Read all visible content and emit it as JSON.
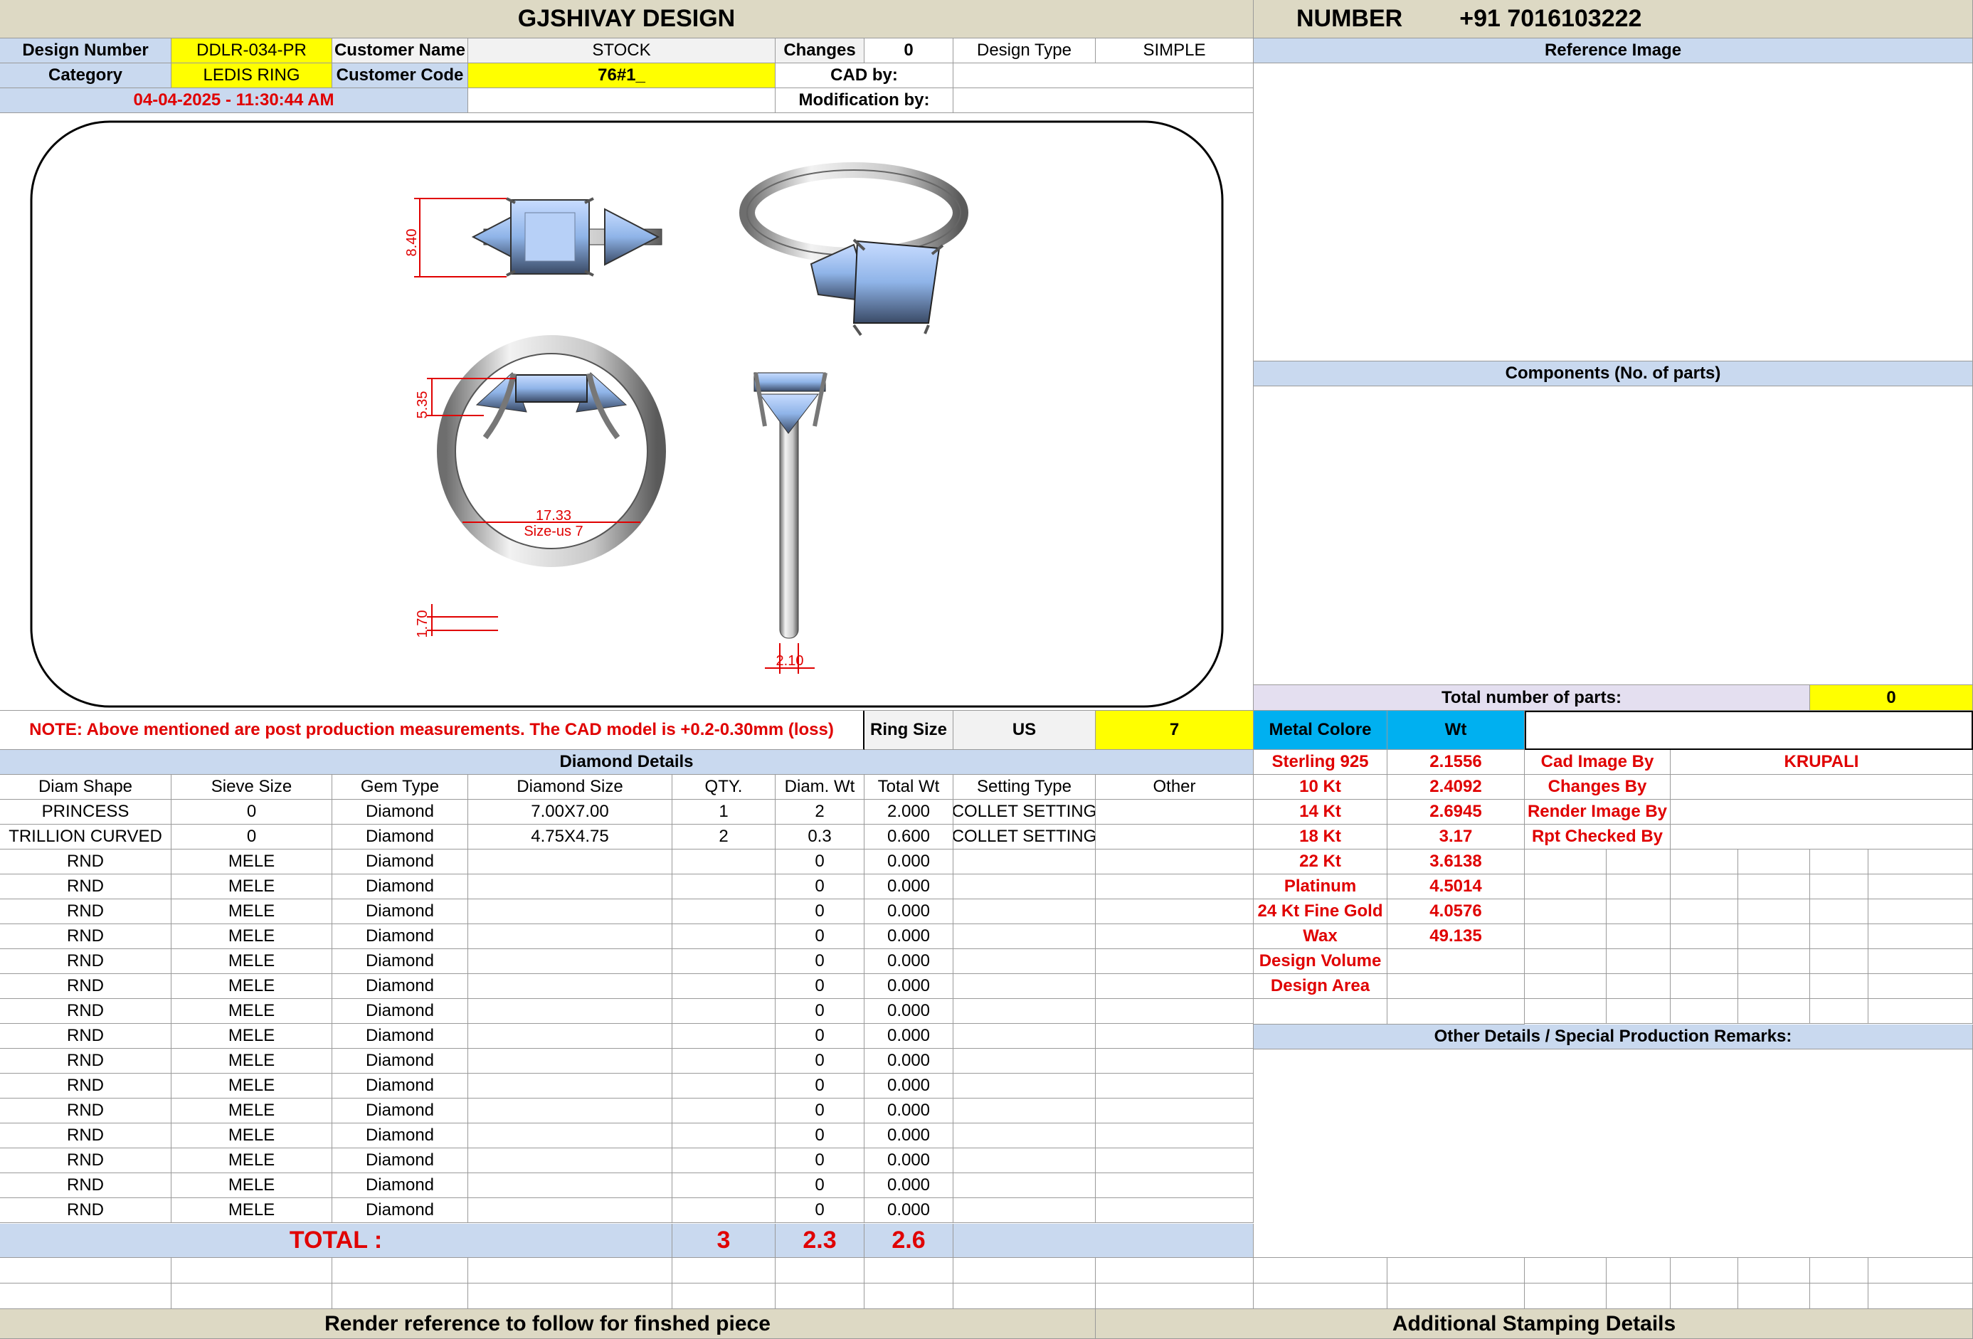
{
  "header": {
    "company": "GJSHIVAY DESIGN",
    "number_label": "NUMBER",
    "number_value": "+91 7016103222"
  },
  "info": {
    "design_number_label": "Design Number",
    "design_number": "DDLR-034-PR",
    "customer_name_label": "Customer Name",
    "customer_name": "STOCK",
    "changes_label": "Changes",
    "changes": "0",
    "design_type_label": "Design Type",
    "design_type": "SIMPLE",
    "category_label": "Category",
    "category": "LEDIS RING",
    "customer_code_label": "Customer Code",
    "customer_code": "76#1_",
    "cad_by_label": "CAD by:",
    "cad_by": "",
    "modification_by_label": "Modification by:",
    "modification_by": "",
    "timestamp": "04-04-2025 - 11:30:44 AM"
  },
  "drawing": {
    "dim_top_height": "8.40",
    "dim_head_height": "5.35",
    "dim_inner_diameter": "17.33",
    "dim_size": "Size-us 7",
    "dim_shank_thickness": "1.70",
    "dim_shank_width": "2.10"
  },
  "right_panel": {
    "reference_image": "Reference Image",
    "components": "Components (No. of parts)",
    "total_parts_label": "Total number of parts:",
    "total_parts": "0"
  },
  "note": "NOTE: Above mentioned are post production measurements. The CAD model is +0.2-0.30mm (loss)",
  "ring_size": {
    "label": "Ring Size",
    "system": "US",
    "value": "7"
  },
  "metal": {
    "header_colore": "Metal Colore",
    "header_wt": "Wt",
    "rows": [
      {
        "name": "Sterling 925",
        "wt": "2.1556"
      },
      {
        "name": "10 Kt",
        "wt": "2.4092"
      },
      {
        "name": "14 Kt",
        "wt": "2.6945"
      },
      {
        "name": "18 Kt",
        "wt": "3.17"
      },
      {
        "name": "22 Kt",
        "wt": "3.6138"
      },
      {
        "name": "Platinum",
        "wt": "4.5014"
      },
      {
        "name": "24 Kt Fine Gold",
        "wt": "4.0576"
      },
      {
        "name": "Wax",
        "wt": "49.135"
      },
      {
        "name": "Design Volume",
        "wt": ""
      },
      {
        "name": "Design Area",
        "wt": ""
      }
    ]
  },
  "credits": [
    {
      "label": "Cad Image By",
      "value": "KRUPALI"
    },
    {
      "label": "Changes By",
      "value": ""
    },
    {
      "label": "Render Image By",
      "value": ""
    },
    {
      "label": "Rpt Checked By",
      "value": ""
    }
  ],
  "other_details": "Other Details / Special Production Remarks:",
  "diamond": {
    "title": "Diamond Details",
    "headers": [
      "Diam Shape",
      "Sieve Size",
      "Gem Type",
      "Diamond Size",
      "QTY.",
      "Diam. Wt",
      "Total Wt",
      "Setting Type",
      "Other"
    ],
    "rows": [
      [
        "PRINCESS",
        "0",
        "Diamond",
        "7.00X7.00",
        "1",
        "2",
        "2.000",
        "COLLET SETTING",
        ""
      ],
      [
        "TRILLION CURVED",
        "0",
        "Diamond",
        "4.75X4.75",
        "2",
        "0.3",
        "0.600",
        "COLLET SETTING",
        ""
      ],
      [
        "RND",
        "MELE",
        "Diamond",
        "",
        "",
        "0",
        "0.000",
        "",
        ""
      ],
      [
        "RND",
        "MELE",
        "Diamond",
        "",
        "",
        "0",
        "0.000",
        "",
        ""
      ],
      [
        "RND",
        "MELE",
        "Diamond",
        "",
        "",
        "0",
        "0.000",
        "",
        ""
      ],
      [
        "RND",
        "MELE",
        "Diamond",
        "",
        "",
        "0",
        "0.000",
        "",
        ""
      ],
      [
        "RND",
        "MELE",
        "Diamond",
        "",
        "",
        "0",
        "0.000",
        "",
        ""
      ],
      [
        "RND",
        "MELE",
        "Diamond",
        "",
        "",
        "0",
        "0.000",
        "",
        ""
      ],
      [
        "RND",
        "MELE",
        "Diamond",
        "",
        "",
        "0",
        "0.000",
        "",
        ""
      ],
      [
        "RND",
        "MELE",
        "Diamond",
        "",
        "",
        "0",
        "0.000",
        "",
        ""
      ],
      [
        "RND",
        "MELE",
        "Diamond",
        "",
        "",
        "0",
        "0.000",
        "",
        ""
      ],
      [
        "RND",
        "MELE",
        "Diamond",
        "",
        "",
        "0",
        "0.000",
        "",
        ""
      ],
      [
        "RND",
        "MELE",
        "Diamond",
        "",
        "",
        "0",
        "0.000",
        "",
        ""
      ],
      [
        "RND",
        "MELE",
        "Diamond",
        "",
        "",
        "0",
        "0.000",
        "",
        ""
      ],
      [
        "RND",
        "MELE",
        "Diamond",
        "",
        "",
        "0",
        "0.000",
        "",
        ""
      ],
      [
        "RND",
        "MELE",
        "Diamond",
        "",
        "",
        "0",
        "0.000",
        "",
        ""
      ],
      [
        "RND",
        "MELE",
        "Diamond",
        "",
        "",
        "0",
        "0.000",
        "",
        ""
      ]
    ],
    "total_label": "TOTAL :",
    "total_qty": "3",
    "total_diam_wt": "2.3",
    "total_wt": "2.6"
  },
  "footer": {
    "left": "Render reference to follow for finshed piece",
    "right": "Additional Stamping Details"
  },
  "colors": {
    "yellow": "#ffff00",
    "header_blue": "#c9d9ef",
    "beige": "#ddd9c4",
    "cyan": "#00b0f0",
    "red_text": "#e00000",
    "stone_blue": "#8fb4e8"
  }
}
